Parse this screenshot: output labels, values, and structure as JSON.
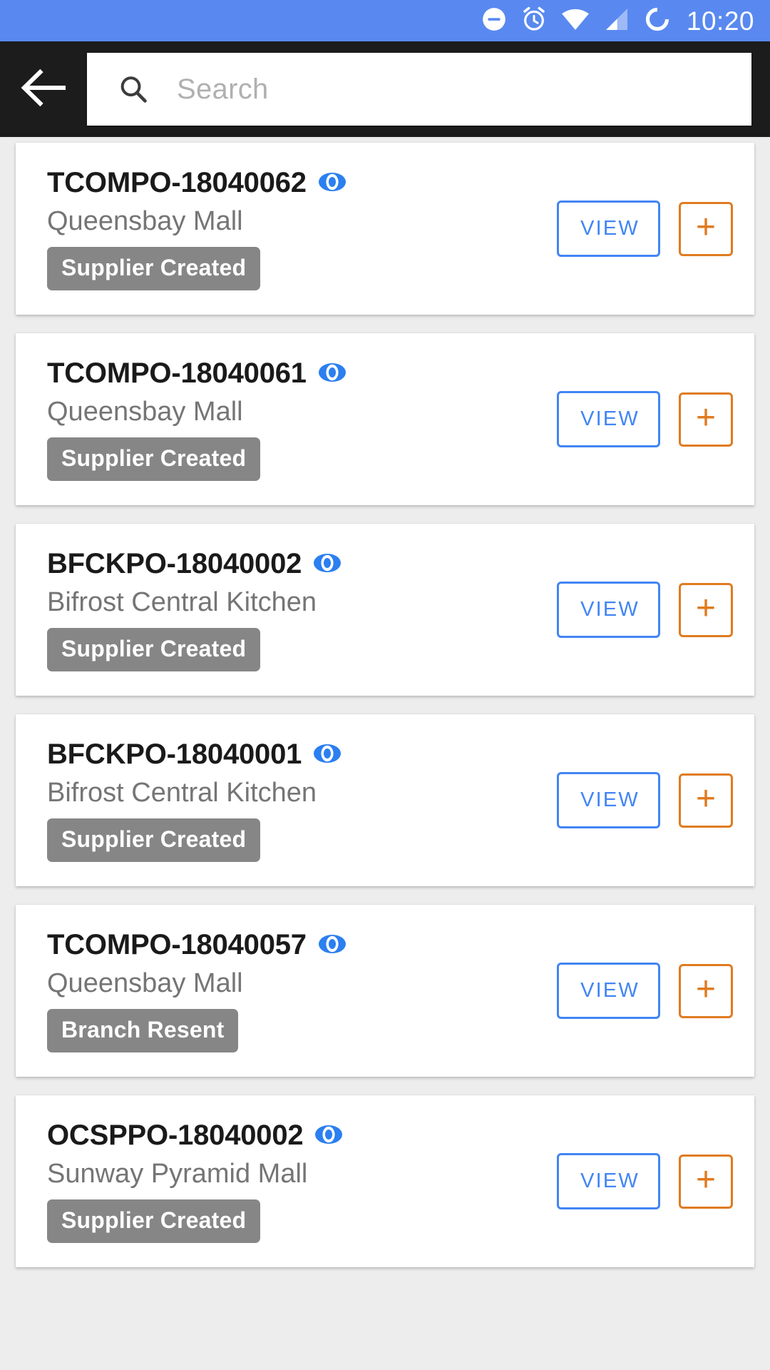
{
  "status_bar": {
    "time": "10:20",
    "background_color": "#5989f0",
    "icons": [
      "do-not-disturb-icon",
      "alarm-clock-icon",
      "wifi-icon",
      "cellular-signal-icon",
      "battery-circle-icon"
    ]
  },
  "app_bar": {
    "background_color": "#1c1c1c",
    "back_label": "back-arrow-icon",
    "search": {
      "value": "",
      "placeholder": "Search",
      "icon": "search-icon"
    }
  },
  "theme": {
    "page_background": "#ededed",
    "card_background": "#ffffff",
    "accent_blue": "#4285f4",
    "accent_orange": "#e07b20",
    "badge_gray": "#868686",
    "title_color": "#1a1a1a",
    "subtitle_color": "#757575"
  },
  "actions": {
    "view_label": "VIEW",
    "add_label": "+"
  },
  "orders": [
    {
      "code": "TCOMPO-18040062",
      "location": "Queensbay Mall",
      "status": "Supplier Created"
    },
    {
      "code": "TCOMPO-18040061",
      "location": "Queensbay Mall",
      "status": "Supplier Created"
    },
    {
      "code": "BFCKPO-18040002",
      "location": "Bifrost Central Kitchen",
      "status": "Supplier Created"
    },
    {
      "code": "BFCKPO-18040001",
      "location": "Bifrost Central Kitchen",
      "status": "Supplier Created"
    },
    {
      "code": "TCOMPO-18040057",
      "location": "Queensbay Mall",
      "status": "Branch Resent"
    },
    {
      "code": "OCSPPO-18040002",
      "location": "Sunway Pyramid Mall",
      "status": "Supplier Created"
    }
  ]
}
